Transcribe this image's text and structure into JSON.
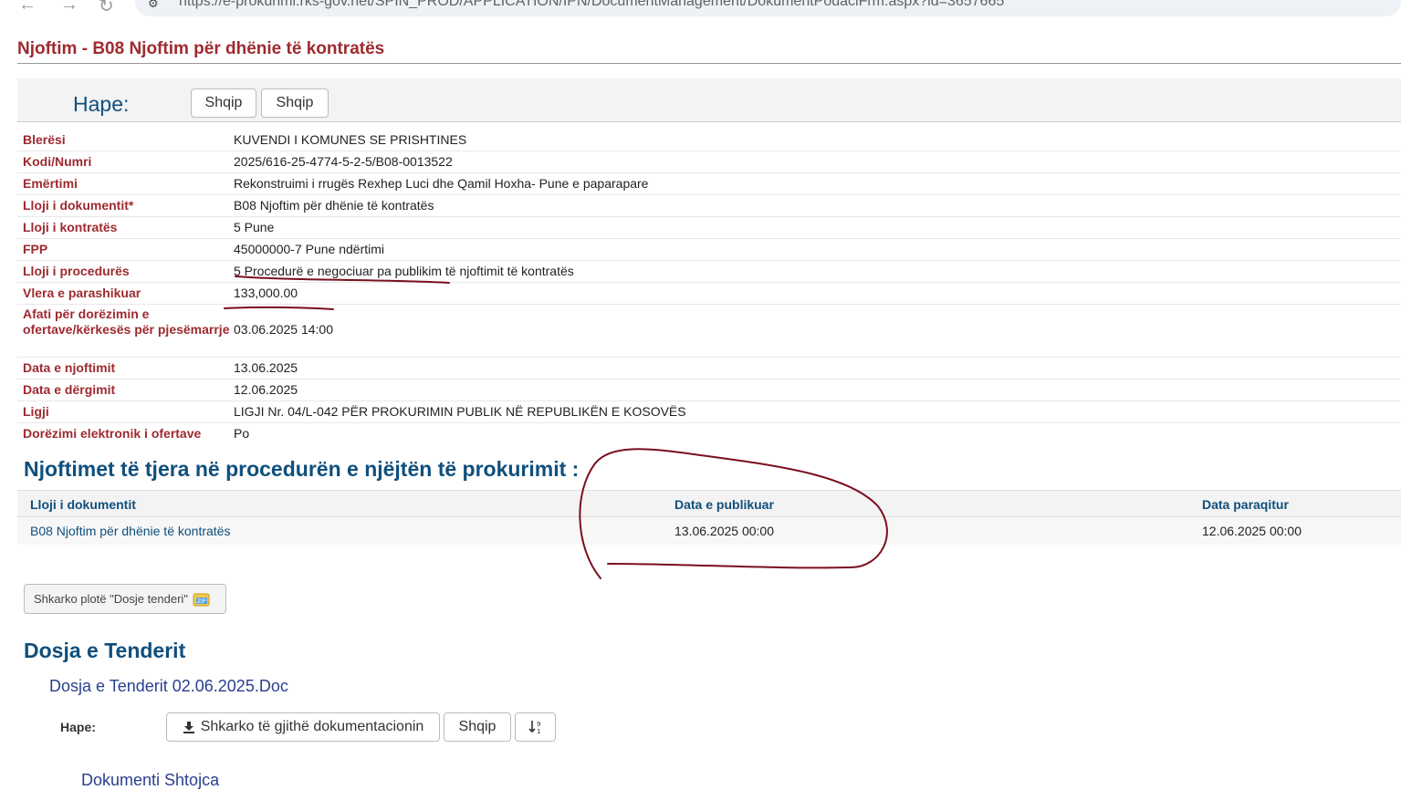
{
  "browser": {
    "url": "https://e-prokurimi.rks-gov.net/SPIN_PROD/APPLICATION/IPN/DocumentManagement/DokumentPodaciFrm.aspx?id=3657665"
  },
  "page": {
    "title": "Njoftim - B08 Njoftim për dhënie të kontratës"
  },
  "open_bar": {
    "label": "Hape:",
    "buttons": [
      "Shqip",
      "Shqip"
    ]
  },
  "details": [
    {
      "label": "Blerësi",
      "value": "KUVENDI I KOMUNES SE PRISHTINES"
    },
    {
      "label": "Kodi/Numri",
      "value": "2025/616-25-4774-5-2-5/B08-0013522"
    },
    {
      "label": "Emërtimi",
      "value": "Rekonstruimi i rrugës Rexhep Luci dhe Qamil Hoxha- Pune e paparapare"
    },
    {
      "label": "Lloji i dokumentit*",
      "value": "B08 Njoftim për dhënie të kontratës"
    },
    {
      "label": "Lloji i kontratës",
      "value": "5 Pune"
    },
    {
      "label": "FPP",
      "value": "45000000-7 Pune ndërtimi"
    },
    {
      "label": "Lloji i procedurës",
      "value": "5 Procedurë e negociuar pa publikim të njoftimit të kontratës"
    },
    {
      "label": "Vlera e parashikuar",
      "value": "133,000.00"
    },
    {
      "label": "Afati për dorëzimin e ofertave/kërkesës për pjesëmarrje",
      "value": "03.06.2025 14:00"
    },
    {
      "label": "Data e njoftimit",
      "value": "13.06.2025"
    },
    {
      "label": "Data e dërgimit",
      "value": "12.06.2025"
    },
    {
      "label": "Ligji",
      "value": "LIGJI Nr. 04/L-042 PËR PROKURIMIN PUBLIK NË REPUBLIKËN E KOSOVËS"
    },
    {
      "label": "Dorëzimi elektronik i ofertave",
      "value": "Po"
    }
  ],
  "other_notices": {
    "title": "Njoftimet të tjera në procedurën e njëjtën të prokurimit :",
    "columns": [
      "Lloji i dokumentit",
      "Data e publikuar",
      "Data paraqitur"
    ],
    "rows": [
      [
        "B08 Njoftim për dhënie të kontratës",
        "13.06.2025 00:00",
        "12.06.2025 00:00"
      ]
    ]
  },
  "download_full_label": "Shkarko plotë \"Dosje tenderi\"",
  "tender_dossier": {
    "title": "Dosja e Tenderit",
    "subtitle": "Dosja e Tenderit 02.06.2025.Doc",
    "open_label": "Hape:",
    "download_all_label": "Shkarko të gjithë dokumentacionin",
    "lang_label": "Shqip",
    "next_link": "Dokumenti Shtojca"
  },
  "colors": {
    "label_red": "#9e2a2f",
    "heading_blue": "#0f4f7d",
    "annotation": "#7a0f1f"
  }
}
